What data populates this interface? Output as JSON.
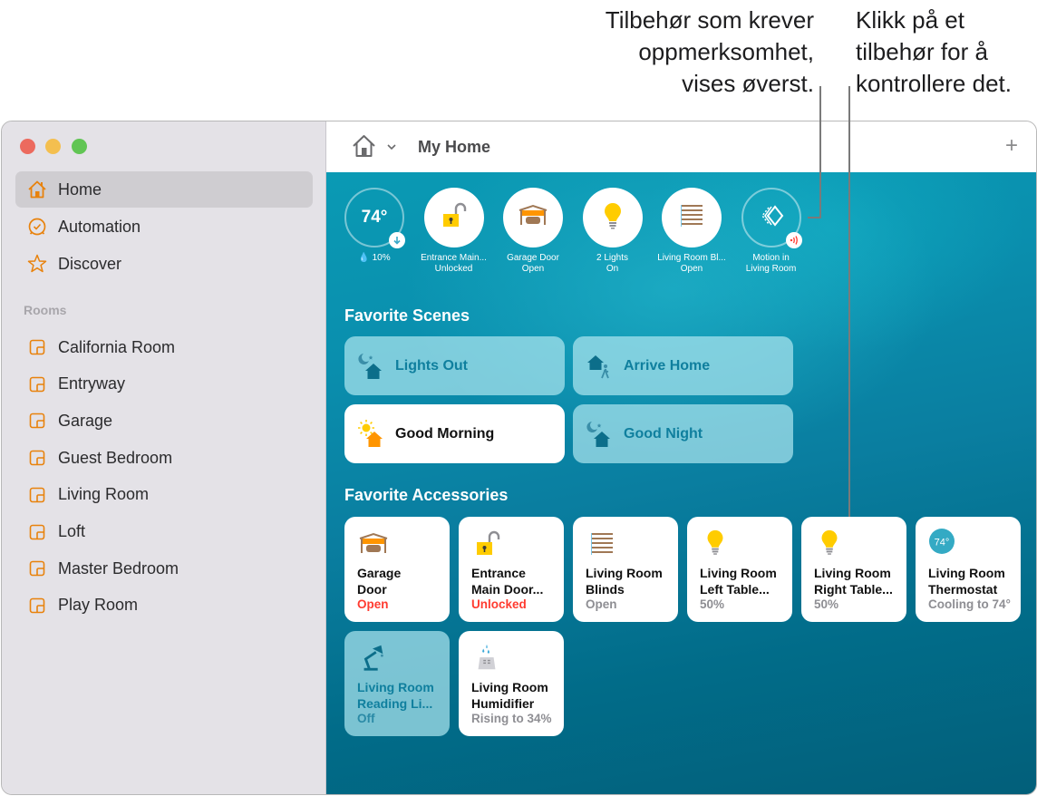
{
  "callouts": {
    "left": [
      "Tilbehør som krever",
      "oppmerksomhet,",
      "vises øverst."
    ],
    "right": [
      "Klikk på et",
      "tilbehør for å",
      "kontrollere det."
    ]
  },
  "window": {
    "title": "My Home",
    "add_button": "+"
  },
  "sidebar": {
    "nav": [
      {
        "label": "Home",
        "icon": "house-icon",
        "selected": true
      },
      {
        "label": "Automation",
        "icon": "clock-icon",
        "selected": false
      },
      {
        "label": "Discover",
        "icon": "star-icon",
        "selected": false
      }
    ],
    "rooms_header": "Rooms",
    "rooms": [
      "California Room",
      "Entryway",
      "Garage",
      "Guest Bedroom",
      "Living Room",
      "Loft",
      "Master Bedroom",
      "Play Room"
    ]
  },
  "status_row": [
    {
      "name": "thermostat",
      "line1": "74°",
      "line2": "💧 10%",
      "kind": "climate"
    },
    {
      "name": "entrance-main-door",
      "line1": "Entrance Main...",
      "line2": "Unlocked"
    },
    {
      "name": "garage-door",
      "line1": "Garage Door",
      "line2": "Open"
    },
    {
      "name": "lights",
      "line1": "2 Lights",
      "line2": "On"
    },
    {
      "name": "living-room-blinds",
      "line1": "Living Room Bl...",
      "line2": "Open"
    },
    {
      "name": "motion",
      "line1": "Motion in",
      "line2": "Living Room"
    }
  ],
  "scenes": {
    "title": "Favorite Scenes",
    "items": [
      {
        "label": "Lights Out",
        "active": false
      },
      {
        "label": "Arrive Home",
        "active": false
      },
      {
        "label": "Good Morning",
        "active": true
      },
      {
        "label": "Good Night",
        "active": false
      }
    ]
  },
  "accessories": {
    "title": "Favorite Accessories",
    "items": [
      {
        "name_line1": "Garage",
        "name_line2": "Door",
        "status": "Open",
        "alert": true,
        "on": true
      },
      {
        "name_line1": "Entrance",
        "name_line2": "Main Door...",
        "status": "Unlocked",
        "alert": true,
        "on": true
      },
      {
        "name_line1": "Living Room",
        "name_line2": "Blinds",
        "status": "Open",
        "alert": false,
        "on": true
      },
      {
        "name_line1": "Living Room",
        "name_line2": "Left Table...",
        "status": "50%",
        "alert": false,
        "on": true
      },
      {
        "name_line1": "Living Room",
        "name_line2": "Right Table...",
        "status": "50%",
        "alert": false,
        "on": true
      },
      {
        "name_line1": "Living Room",
        "name_line2": "Thermostat",
        "status": "Cooling to 74°",
        "alert": false,
        "on": true,
        "badge": "74°"
      },
      {
        "name_line1": "Living Room",
        "name_line2": "Reading Li...",
        "status": "Off",
        "alert": false,
        "on": false
      },
      {
        "name_line1": "Living Room",
        "name_line2": "Humidifier",
        "status": "Rising to 34%",
        "alert": false,
        "on": true
      }
    ]
  },
  "colors": {
    "accent_orange": "#e8820c",
    "alert_red": "#ff3b30",
    "teal_text": "#0f7f9e",
    "bulb_yellow": "#ffcc00"
  }
}
